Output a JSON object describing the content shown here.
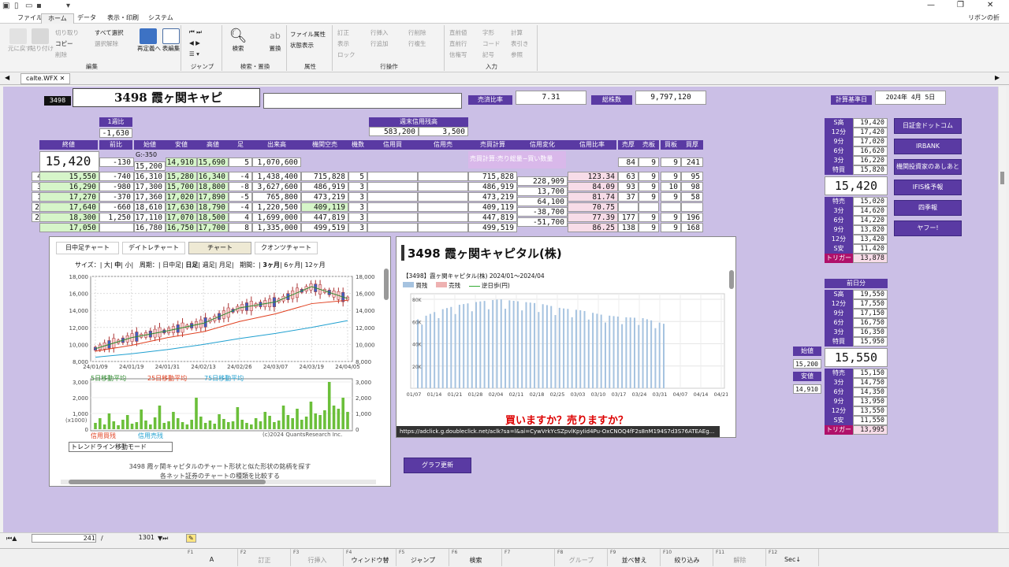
{
  "title": {
    "right": "リボンの折り畳み"
  },
  "menu": [
    "ファイル",
    "ホーム",
    "データ",
    "表示・印刷",
    "システム"
  ],
  "ribbon": {
    "undo": "元に戻す",
    "paste": "貼り付け",
    "cut": "切り取り",
    "copy": "コピー",
    "delete": "削除",
    "select_all": "すべて選択",
    "deselect": "選択解除",
    "redefine": "再定義へ",
    "table_edit": "表編集",
    "g_edit": "編集",
    "g_jump": "ジャンプ",
    "search": "検索",
    "replace": "置換",
    "g_search": "検索・置換",
    "file_attr": "ファイル属性",
    "status_disp": "状態表示",
    "g_attr": "属性",
    "fix": "訂正",
    "show": "表示",
    "lock": "ロック",
    "row_insert": "行挿入",
    "row_add": "行追加",
    "row_delete": "行削除",
    "row_copy": "行複生",
    "g_row": "行操作",
    "prev_row": "直前値",
    "prev_line": "直前行",
    "credit": "信権写",
    "letters": "字形",
    "code": "コード",
    "mark": "記号",
    "calc": "計算",
    "table_ref": "表引き",
    "ref": "参照",
    "g_input": "入力"
  },
  "doc_tab": "calte.WFX",
  "stock": {
    "code": "3498",
    "name": "3498 霞ヶ関キャピ",
    "memo": ""
  },
  "labels": {
    "sell_ratio": "売済比率",
    "total_shares": "総株数",
    "calc_date": "計算基準日",
    "week_change": "1週比",
    "weekly_margin": "週末信用残高",
    "open": "始値",
    "low": "安値",
    "high": "高値",
    "pos": "足",
    "volume": "出来高",
    "inst_short": "機関空売",
    "count": "機数",
    "credit_buy": "信用買",
    "credit_sell": "信用売",
    "net_calc": "売買計算",
    "credit_change": "信用変化",
    "credit_ratio": "信用比率",
    "ask_thick": "売厚",
    "ask_board": "売板",
    "bid_board": "買板",
    "bid_thick": "買厚",
    "close": "終値",
    "prev": "前比",
    "net_note": "売買計算:売り総量−買い数量",
    "gvalue": "G:-350"
  },
  "values": {
    "sell_ratio": "7.31",
    "total_shares": "9,797,120",
    "calc_date": "2024年 4月 5日",
    "week_change": "-1,630",
    "margin_buy": "583,200",
    "margin_sell": "3,500",
    "close": "15,420",
    "prev": "-130",
    "open": "15,200",
    "low": "14,910",
    "high": "15,690",
    "pos": "5",
    "volume": "1,070,600",
    "ask_thick": "84",
    "ask_board": "9",
    "bid_board": "9",
    "bid_thick": "241"
  },
  "rows": [
    {
      "day": "4",
      "close": "15,550",
      "prev": "-740",
      "open": "16,310",
      "low": "15,280",
      "high": "16,340",
      "pos": "-4",
      "vol": "1,438,400",
      "inst": "715,828",
      "cnt": "5",
      "net": "715,828",
      "chg": "228,909",
      "ratio": "123.34",
      "a1": "63",
      "a2": "9",
      "b1": "9",
      "b2": "95"
    },
    {
      "day": "3",
      "close": "16,290",
      "prev": "-980",
      "open": "17,300",
      "low": "15,700",
      "high": "18,800",
      "pos": "-8",
      "vol": "3,627,600",
      "inst": "486,919",
      "cnt": "3",
      "net": "486,919",
      "chg": "13,700",
      "ratio": "84.09",
      "a1": "93",
      "a2": "9",
      "b1": "10",
      "b2": "98"
    },
    {
      "day": "1",
      "close": "17,270",
      "prev": "-370",
      "open": "17,360",
      "low": "17,020",
      "high": "17,890",
      "pos": "-5",
      "vol": "765,800",
      "inst": "473,219",
      "cnt": "3",
      "net": "473,219",
      "chg": "64,100",
      "ratio": "81.74",
      "a1": "37",
      "a2": "9",
      "b1": "9",
      "b2": "58"
    },
    {
      "day": "29",
      "close": "17,640",
      "prev": "-660",
      "open": "18,610",
      "low": "17,630",
      "high": "18,790",
      "pos": "-4",
      "vol": "1,220,500",
      "inst": "409,119",
      "cnt": "3",
      "net": "409,119",
      "chg": "-38,700",
      "ratio": "70.75",
      "a1": "",
      "a2": "",
      "b1": "",
      "b2": ""
    },
    {
      "day": "28",
      "close": "18,300",
      "prev": "1,250",
      "open": "17,110",
      "low": "17,070",
      "high": "18,500",
      "pos": "4",
      "vol": "1,699,000",
      "inst": "447,819",
      "cnt": "3",
      "net": "447,819",
      "chg": "-51,700",
      "ratio": "77.39",
      "a1": "177",
      "a2": "9",
      "b1": "9",
      "b2": "196"
    },
    {
      "day": "",
      "close": "17,050",
      "prev": "",
      "open": "16,780",
      "low": "16,750",
      "high": "17,700",
      "pos": "8",
      "vol": "1,335,000",
      "inst": "499,519",
      "cnt": "3",
      "net": "499,519",
      "chg": "",
      "ratio": "86.25",
      "a1": "138",
      "a2": "9",
      "b1": "9",
      "b2": "168"
    }
  ],
  "chart_panel": {
    "tabs": [
      "日中足チャート",
      "デイトレチャート",
      "チャート",
      "クオンツチャート"
    ],
    "size_label": "サイズ：",
    "sizes": [
      "大",
      "中",
      "小"
    ],
    "period_label": "周期：",
    "periods": [
      "日中足",
      "日足",
      "週足",
      "月足"
    ],
    "range_label": "期間：",
    "ranges": [
      "3ヶ月",
      "6ヶ月",
      "12ヶ月"
    ],
    "legend1": [
      "5日移動平均",
      "25日移動平均",
      "75日移動平均"
    ],
    "legend2": [
      "信用買残",
      "信用売残"
    ],
    "copyright": "(c)2024 QuantsResearch Inc.",
    "mode": "トレンドライン移動モード",
    "footer1": "3498 霞ヶ関キャピタルのチャート形状と似た形状の銘柄を探す",
    "footer2": "各ネット証券のチャートの種類を比較する",
    "ylab": [
      "18,000",
      "16,000",
      "14,000",
      "12,000",
      "10,000",
      "8,000"
    ],
    "xlab": [
      "24/01/09",
      "24/01/19",
      "24/01/31",
      "24/02/13",
      "24/02/26",
      "24/03/07",
      "24/03/19",
      "24/04/05"
    ],
    "vlab": [
      "3,000",
      "2,000",
      "1,000",
      "0"
    ],
    "vunit": "(x1000)"
  },
  "right_panel": {
    "title": "3498 霞ヶ関キャピタル(株)",
    "subtitle": "【3498】霞ヶ関キャピタル(株) 2024/01～2024/04",
    "legend": [
      "買残",
      "売残",
      "逆日歩(円)"
    ],
    "ylab": [
      "80K",
      "60K",
      "40K",
      "20K"
    ],
    "xlab": [
      "01/07",
      "01/14",
      "01/21",
      "01/28",
      "02/04",
      "02/11",
      "02/18",
      "02/25",
      "03/03",
      "03/10",
      "03/17",
      "03/24",
      "03/31",
      "04/07",
      "04/14",
      "04/21"
    ],
    "ad": "買いますか？売りますか？",
    "url": "https://adclick.g.doubleclick.net/aclk?sa=l&ai=CywVrkYcSZpvlKpyIid4Pu-OxCNOQ4fF2s8nM194S7d3S76ATEAEg..."
  },
  "graph_button": "グラフ更新",
  "side_buttons": [
    "日証金ドットコム",
    "IRBANK",
    "機関投資家のあしあと",
    "IFIS株予報",
    "四季報",
    "ヤフー!"
  ],
  "pivot1": {
    "labels": [
      "S高",
      "12分",
      "9分",
      "6分",
      "3分",
      "特買"
    ],
    "values": [
      "19,420",
      "17,420",
      "17,020",
      "16,620",
      "16,220",
      "15,820"
    ],
    "main": "15,420",
    "labels2": [
      "特売",
      "3分",
      "6分",
      "9分",
      "12分",
      "S安"
    ],
    "values2": [
      "15,020",
      "14,620",
      "14,220",
      "13,820",
      "13,420",
      "11,420"
    ],
    "trigger": "トリガー",
    "trigger_val": "13,878"
  },
  "pivot2": {
    "head": "前日分",
    "labels": [
      "S高",
      "12分",
      "9分",
      "6分",
      "3分",
      "特買"
    ],
    "values": [
      "19,550",
      "17,550",
      "17,150",
      "16,750",
      "16,350",
      "15,950"
    ],
    "main": "15,550",
    "labels2": [
      "特売",
      "3分",
      "6分",
      "9分",
      "12分",
      "S安"
    ],
    "values2": [
      "15,150",
      "14,750",
      "14,350",
      "13,950",
      "13,550",
      "11,550"
    ],
    "trigger": "トリガー",
    "trigger_val": "13,995"
  },
  "side_open": {
    "open_label": "始値",
    "open": "15,200",
    "low_label": "安値",
    "low": "14,910"
  },
  "status": {
    "pos": "241",
    "sep": "/",
    "total": "1301"
  },
  "fkeys": [
    {
      "n": "F1",
      "l": "A"
    },
    {
      "n": "F2",
      "l": "訂正"
    },
    {
      "n": "F3",
      "l": "行挿入"
    },
    {
      "n": "F4",
      "l": "ウィンドウ替"
    },
    {
      "n": "F5",
      "l": "ジャンプ"
    },
    {
      "n": "F6",
      "l": "検索"
    },
    {
      "n": "F7",
      "l": ""
    },
    {
      "n": "F8",
      "l": "グループ"
    },
    {
      "n": "F9",
      "l": "並べ替え"
    },
    {
      "n": "F10",
      "l": "絞り込み"
    },
    {
      "n": "F11",
      "l": "解除"
    },
    {
      "n": "F12",
      "l": "Sec↓"
    }
  ],
  "chart_data": [
    {
      "type": "line",
      "title": "",
      "x": [
        "24/01/09",
        "24/01/19",
        "24/01/31",
        "24/02/13",
        "24/02/26",
        "24/03/07",
        "24/03/19",
        "24/04/05"
      ],
      "series": [
        {
          "name": "5日移動平均",
          "values": [
            9500,
            10800,
            11600,
            12500,
            14300,
            15000,
            16800,
            15400
          ]
        },
        {
          "name": "25日移動平均",
          "values": [
            9200,
            9900,
            10800,
            11500,
            12700,
            13600,
            14800,
            15200
          ]
        },
        {
          "name": "75日移動平均",
          "values": [
            8500,
            8900,
            9400,
            10000,
            10700,
            11300,
            12000,
            12800
          ]
        }
      ],
      "ylim": [
        8000,
        18000
      ]
    },
    {
      "type": "bar",
      "title": "",
      "categories": [
        "01/07",
        "01/14",
        "01/21",
        "01/28",
        "02/04",
        "02/11",
        "02/18",
        "02/25",
        "03/03",
        "03/10",
        "03/17",
        "03/24",
        "03/31"
      ],
      "series": [
        {
          "name": "買残",
          "values": [
            62000,
            70000,
            75000,
            78000,
            80000,
            78000,
            76000,
            72000,
            70000,
            66000,
            64000,
            63000,
            58000
          ]
        }
      ],
      "ylim": [
        0,
        85000
      ]
    }
  ]
}
